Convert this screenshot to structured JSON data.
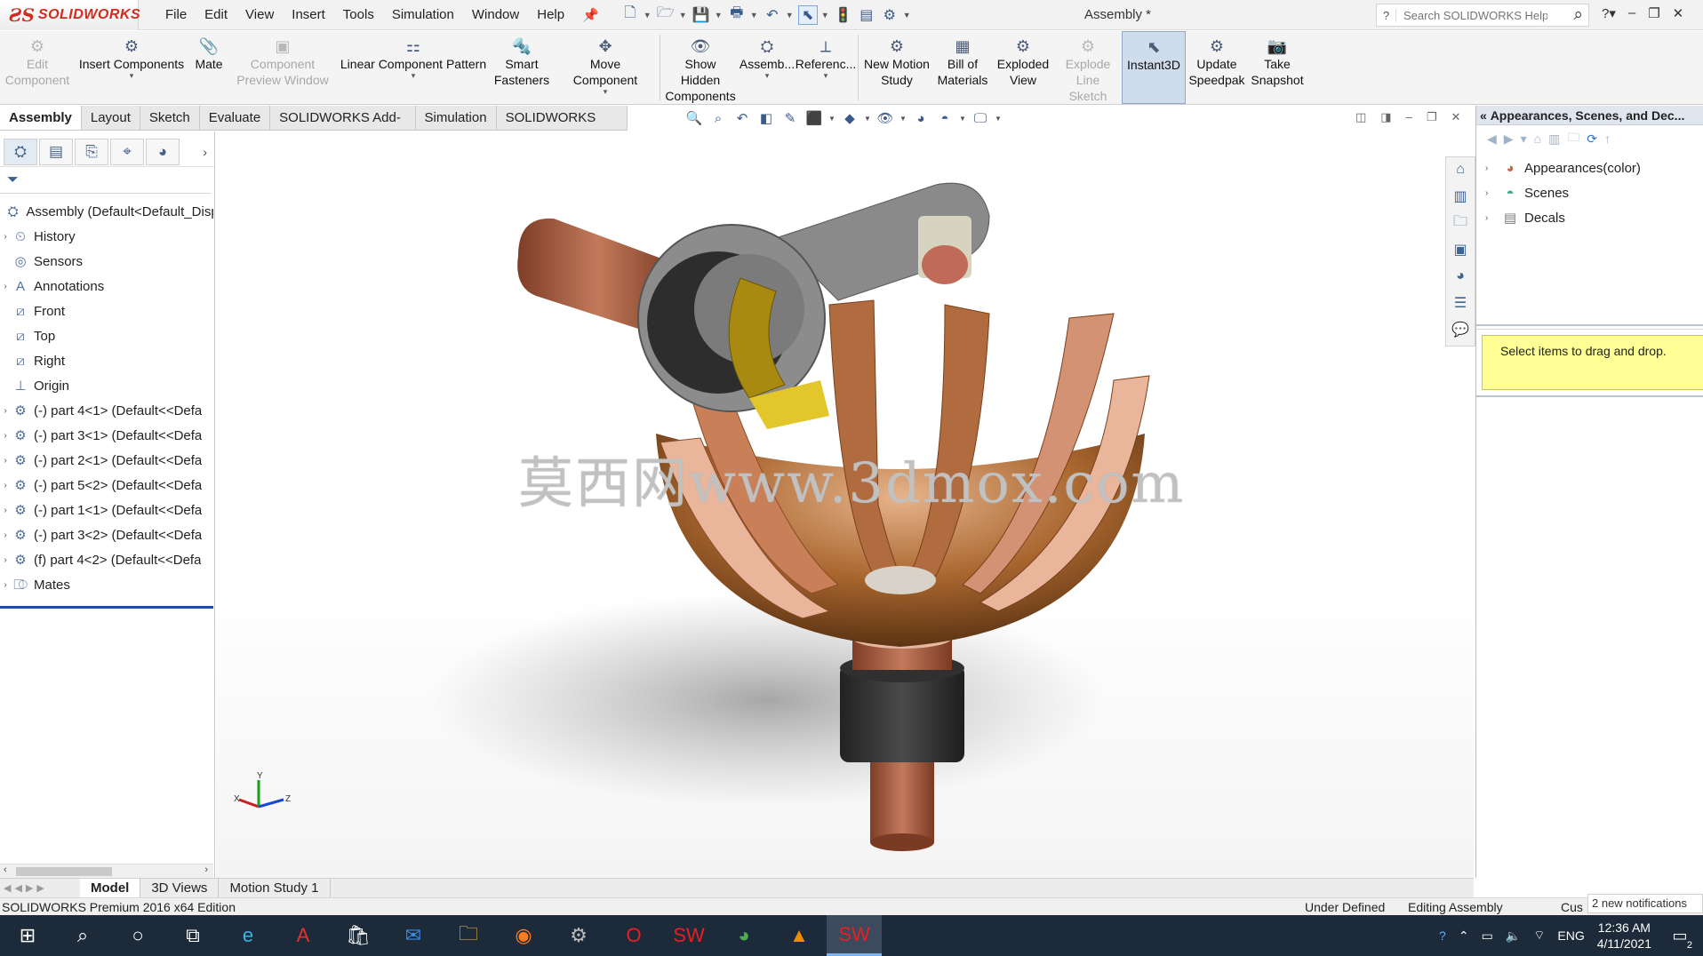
{
  "app": {
    "logo_text": "SOLIDWORKS",
    "menu": [
      "File",
      "Edit",
      "View",
      "Insert",
      "Tools",
      "Simulation",
      "Window",
      "Help"
    ],
    "document_title": "Assembly *",
    "search_placeholder": "Search SOLIDWORKS Help"
  },
  "command_manager": {
    "edit_component": "Edit\nComponent",
    "insert_components": "Insert Components",
    "mate": "Mate",
    "component_preview": "Component\nPreview Window",
    "linear_pattern": "Linear Component Pattern",
    "smart_fasteners": "Smart\nFasteners",
    "move_component": "Move Component",
    "show_hidden": "Show Hidden\nComponents",
    "assembly_features": "Assemb...",
    "reference_geometry": "Referenc...",
    "new_motion_study": "New Motion\nStudy",
    "bill_of_materials": "Bill of\nMaterials",
    "exploded_view": "Exploded\nView",
    "explode_line_sketch": "Explode\nLine Sketch",
    "instant3d": "Instant3D",
    "update_speedpak": "Update\nSpeedpak",
    "take_snapshot": "Take\nSnapshot"
  },
  "tabs": [
    "Assembly",
    "Layout",
    "Sketch",
    "Evaluate",
    "SOLIDWORKS Add-Ins",
    "Simulation",
    "SOLIDWORKS MBD"
  ],
  "feature_tree": {
    "root": "Assembly  (Default<Default_Disp",
    "items": [
      "History",
      "Sensors",
      "Annotations",
      "Front",
      "Top",
      "Right",
      "Origin",
      "(-) part 4<1> (Default<<Defa",
      "(-) part 3<1> (Default<<Defa",
      "(-) part 2<1> (Default<<Defa",
      "(-) part 5<2> (Default<<Defa",
      "(-) part 1<1> (Default<<Defa",
      "(-) part 3<2> (Default<<Defa",
      "(f) part 4<2> (Default<<Defa",
      "Mates"
    ]
  },
  "viewport": {
    "watermark": "莫西网www.3dmox.com",
    "triad": {
      "x": "X",
      "y": "Y",
      "z": "Z"
    }
  },
  "task_pane": {
    "title": "Appearances, Scenes, and Dec...",
    "items": [
      "Appearances(color)",
      "Scenes",
      "Decals"
    ],
    "drop_hint": "Select items to drag and drop."
  },
  "bottom_tabs": [
    "Model",
    "3D Views",
    "Motion Study 1"
  ],
  "status": {
    "edition": "SOLIDWORKS Premium 2016 x64 Edition",
    "defined": "Under Defined",
    "mode": "Editing Assembly",
    "custom": "Cus",
    "notification": "2 new notifications"
  },
  "taskbar": {
    "language": "ENG",
    "time": "12:36 AM",
    "date": "4/11/2021",
    "notif_count": "2"
  },
  "colors": {
    "brand_red": "#d52b1e",
    "copper": "#b87044",
    "tip_hint_bg": "#ffff96",
    "taskbar_bg": "#1c2a3a"
  }
}
